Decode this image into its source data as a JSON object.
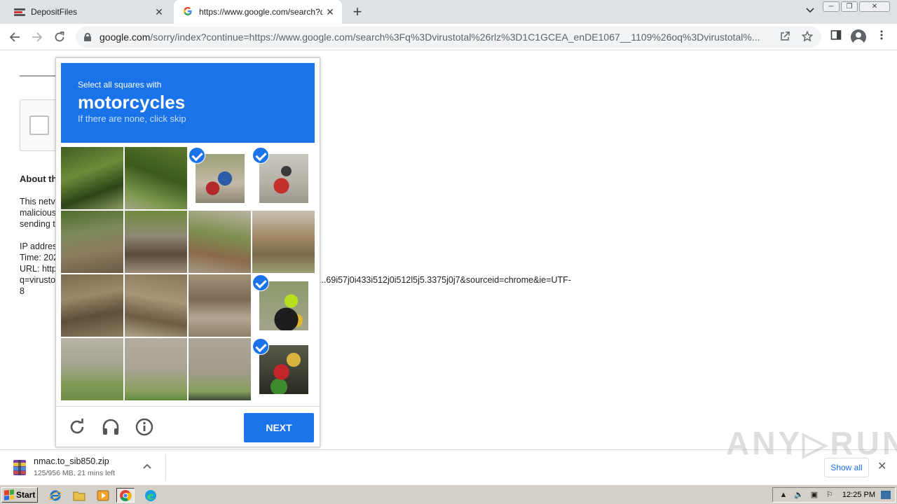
{
  "browser": {
    "tabs": [
      {
        "title": "DepositFiles",
        "close": "✕"
      },
      {
        "title": "https://www.google.com/search?q=",
        "close": "✕"
      }
    ],
    "new_tab": "+",
    "url_host": "google.com",
    "url_rest": "/sorry/index?continue=https://www.google.com/search%3Fq%3Dvirustotal%26rlz%3D1C1GCEA_enDE1067__1109%26oq%3Dvirustotal%..."
  },
  "page": {
    "heading": "About th",
    "para1_l1": "This netv",
    "para1_l2": "malicious",
    "para1_l3": "sending t",
    "ip": "IP addres",
    "time": "Time: 202",
    "url": "URL: http",
    "q_line": "q=virusto",
    "q_tail": "...69i57j0i433i512j0i512l5j5.3375j0j7&sourceid=chrome&ie=UTF-",
    "last_line": "8"
  },
  "captcha": {
    "instruction": "Select all squares with",
    "target": "motorcycles",
    "hint": "If there are none, click skip",
    "next_label": "NEXT",
    "selected_tiles": [
      2,
      3,
      11,
      15
    ]
  },
  "downloads": {
    "filename": "nmac.to_sib850.zip",
    "status": "125/956 MB, 21 mins left",
    "show_all": "Show all"
  },
  "watermark": "ANY▷RUN",
  "taskbar": {
    "start_label": "Start",
    "clock": "12:25 PM"
  }
}
